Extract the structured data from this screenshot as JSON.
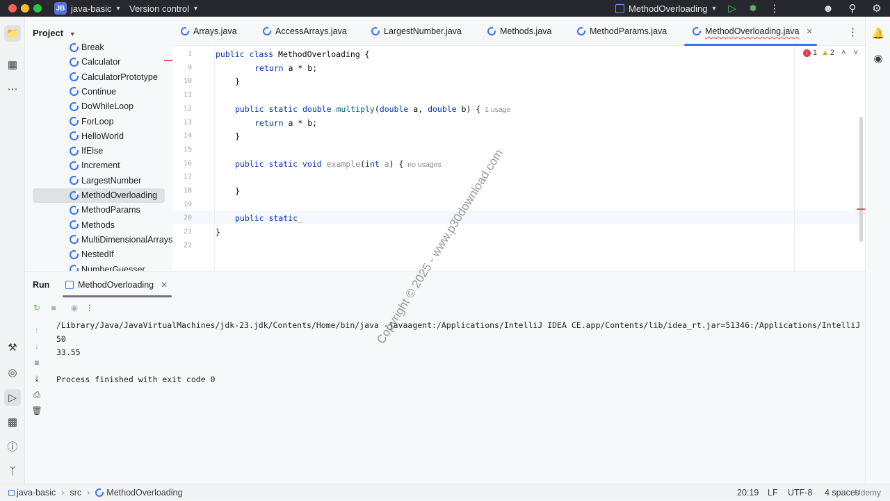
{
  "titlebar": {
    "project_badge": "JB",
    "project_name": "java-basic",
    "vcs_label": "Version control",
    "run_config": "MethodOverloading"
  },
  "project_panel": {
    "title": "Project",
    "items": [
      "Break",
      "Calculator",
      "CalculatorPrototype",
      "Continue",
      "DoWhileLoop",
      "ForLoop",
      "HelloWorld",
      "IfElse",
      "Increment",
      "LargestNumber",
      "MethodOverloading",
      "MethodParams",
      "Methods",
      "MultiDimensionalArrays",
      "NestedIf",
      "NumberGuesser"
    ],
    "selected": "MethodOverloading"
  },
  "tabs": [
    "Arrays.java",
    "AccessArrays.java",
    "LargestNumber.java",
    "Methods.java",
    "MethodParams.java",
    "MethodOverloading.java"
  ],
  "active_tab": "MethodOverloading.java",
  "inspections": {
    "errors": "1",
    "warnings": "2"
  },
  "editor": {
    "lines": [
      {
        "num": "1",
        "code": "public class MethodOverloading {"
      },
      {
        "num": "9",
        "code": "return a * b;"
      },
      {
        "num": "10",
        "code": "}"
      },
      {
        "num": "11",
        "code": ""
      },
      {
        "num": "12",
        "code": "public static double multiply(double a, double b) {",
        "hint": "1 usage"
      },
      {
        "num": "13",
        "code": "return a * b;"
      },
      {
        "num": "14",
        "code": "}"
      },
      {
        "num": "15",
        "code": ""
      },
      {
        "num": "16",
        "code": "public static void example(int a) {",
        "hint": "no usages"
      },
      {
        "num": "17",
        "code": ""
      },
      {
        "num": "18",
        "code": "}"
      },
      {
        "num": "19",
        "code": ""
      },
      {
        "num": "20",
        "code": "public static"
      },
      {
        "num": "21",
        "code": "}"
      },
      {
        "num": "22",
        "code": ""
      }
    ]
  },
  "run_panel": {
    "title": "Run",
    "tab": "MethodOverloading",
    "console": [
      "/Library/Java/JavaVirtualMachines/jdk-23.jdk/Contents/Home/bin/java -javaagent:/Applications/IntelliJ IDEA CE.app/Contents/lib/idea_rt.jar=51346:/Applications/IntelliJ",
      "50",
      "33.55",
      "",
      "Process finished with exit code 0"
    ]
  },
  "statusbar": {
    "crumbs": [
      "java-basic",
      "src",
      "MethodOverloading"
    ],
    "position": "20:19",
    "line_sep": "LF",
    "encoding": "UTF-8",
    "indent": "4 spaces"
  },
  "watermark": "Copyright © 2025 - www.p30download.com",
  "udemy": "Udemy",
  "colors": {
    "accent": "#3574f0",
    "titlebar": "#27282e",
    "keyword": "#0033b3",
    "function": "#00627a"
  }
}
